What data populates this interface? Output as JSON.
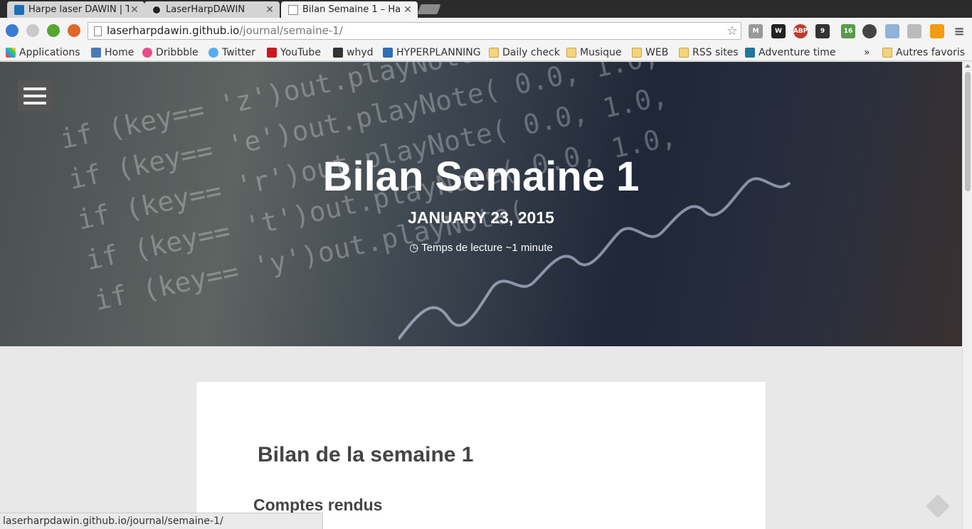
{
  "tabs": [
    {
      "title": "Harpe laser DAWIN | Tr",
      "icon": "trello-icon",
      "active": false
    },
    {
      "title": "LaserHarpDAWIN",
      "icon": "github-icon",
      "active": false
    },
    {
      "title": "Bilan Semaine 1 – Ha",
      "icon": "page-icon",
      "active": true
    }
  ],
  "address": {
    "host": "laserharpdawin.github.io",
    "path": "/journal/semaine-1/"
  },
  "bookmarks": [
    {
      "label": "Applications",
      "icon": "apps-grid-icon"
    },
    {
      "label": "Home",
      "icon": "home-bucket-icon"
    },
    {
      "label": "Dribbble",
      "icon": "dribbble-icon"
    },
    {
      "label": "Twitter",
      "icon": "twitter-icon"
    },
    {
      "label": "YouTube",
      "icon": "youtube-icon"
    },
    {
      "label": "whyd",
      "icon": "whyd-icon"
    },
    {
      "label": "HYPERPLANNING",
      "icon": "hyperplanning-icon"
    },
    {
      "label": "Daily check",
      "icon": "folder-icon"
    },
    {
      "label": "Musique",
      "icon": "folder-icon"
    },
    {
      "label": "WEB",
      "icon": "folder-icon"
    },
    {
      "label": "RSS sites",
      "icon": "folder-icon"
    },
    {
      "label": "Adventure time",
      "icon": "wordpress-icon"
    }
  ],
  "bookmarks_overflow": "»",
  "other_bookmarks": "Autres favoris",
  "extension_badges": {
    "d": "9",
    "gr": "16"
  },
  "hero": {
    "title": "Bilan Semaine 1",
    "date": "JANUARY 23, 2015",
    "reading_time": "Temps de lecture ~1 minute"
  },
  "article": {
    "heading": "Bilan de la semaine 1",
    "subheading": "Comptes rendus"
  },
  "status_bar": "laserharpdawin.github.io/journal/semaine-1/"
}
